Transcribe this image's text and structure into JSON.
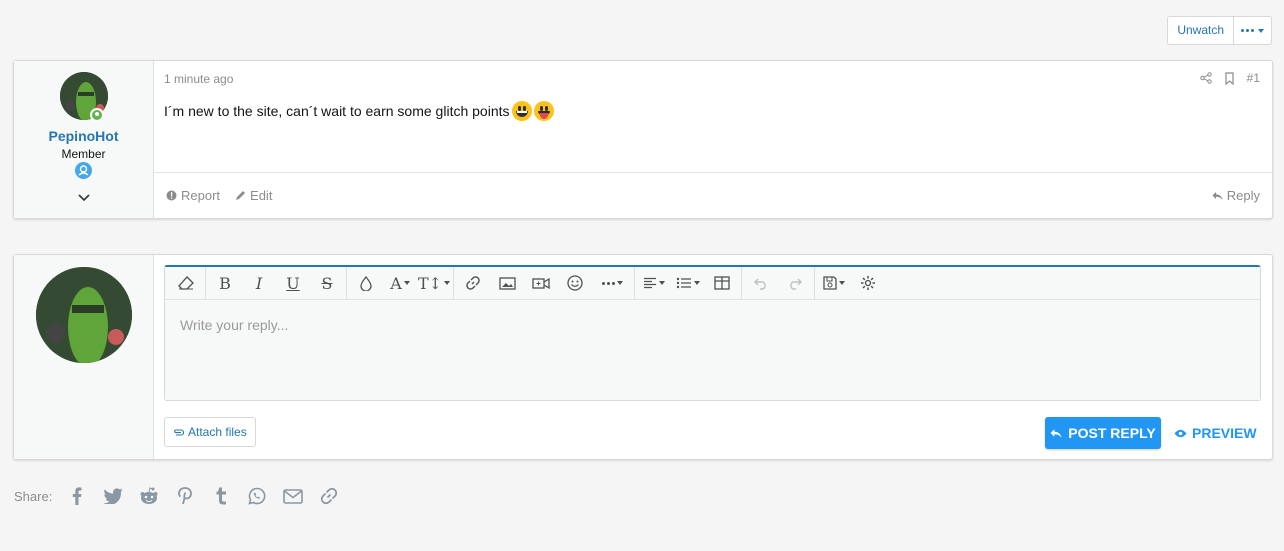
{
  "topbar": {
    "unwatch_label": "Unwatch"
  },
  "post": {
    "username": "PepinoHot",
    "user_title": "Member",
    "date": "1 minute ago",
    "number": "#1",
    "body": "I´m new to the site, can´t wait to earn some glitch points",
    "emojis": [
      "grinning-face",
      "face-with-tongue"
    ],
    "actions": {
      "report": "Report",
      "edit": "Edit",
      "reply": "Reply"
    }
  },
  "reply": {
    "placeholder": "Write your reply...",
    "attach_label": "Attach files",
    "post_reply_label": "POST REPLY",
    "preview_label": "PREVIEW"
  },
  "share": {
    "label": "Share:"
  },
  "colors": {
    "link": "#2577b1",
    "primary": "#2196f3",
    "online": "#63b450"
  }
}
